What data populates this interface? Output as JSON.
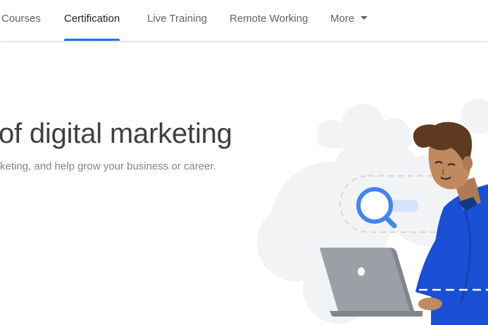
{
  "nav": {
    "items": [
      {
        "label": "Courses"
      },
      {
        "label": "Certification"
      },
      {
        "label": "Live Training"
      },
      {
        "label": "Remote Working"
      },
      {
        "label": "More"
      }
    ]
  },
  "hero": {
    "title": "of digital marketing",
    "subtitle": "keting, and help grow your business or career."
  },
  "colors": {
    "accent": "#1a73e8",
    "shirt": "#1a4fd6",
    "laptop": "#9aa0a6"
  },
  "icons": [
    "chevron-down-icon",
    "search-icon",
    "laptop-icon"
  ]
}
